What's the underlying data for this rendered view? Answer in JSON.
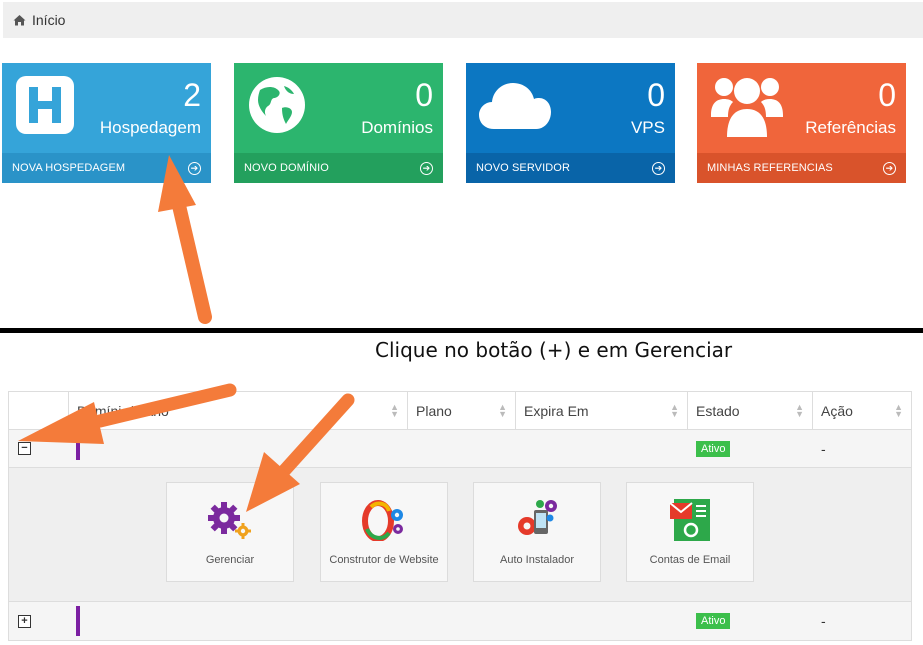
{
  "breadcrumb": {
    "home_icon": "home-icon",
    "label": "Início"
  },
  "tiles": [
    {
      "count": "2",
      "name": "Hospedagem",
      "link": "NOVA HOSPEDAGEM",
      "icon": "hosting-h-icon"
    },
    {
      "count": "0",
      "name": "Domínios",
      "link": "NOVO DOMÍNIO",
      "icon": "globe-icon"
    },
    {
      "count": "0",
      "name": "VPS",
      "link": "NOVO SERVIDOR",
      "icon": "cloud-icon"
    },
    {
      "count": "0",
      "name": "Referências",
      "link": "MINHAS REFERENCIAS",
      "icon": "users-icon"
    }
  ],
  "instruction": "Clique no botão (+) e em Gerenciar",
  "table": {
    "headers": [
      "",
      "Domínio/Plano",
      "Plano",
      "Expira Em",
      "Estado",
      "Ação"
    ],
    "rows": [
      {
        "toggle": "−",
        "status": "Ativo",
        "action": "-"
      },
      {
        "toggle": "+",
        "status": "Ativo",
        "action": "-"
      }
    ]
  },
  "actions": [
    {
      "label": "Gerenciar",
      "icon": "gears-icon"
    },
    {
      "label": "Construtor de Website",
      "icon": "website-builder-icon"
    },
    {
      "label": "Auto Instalador",
      "icon": "auto-installer-icon"
    },
    {
      "label": "Contas de Email",
      "icon": "email-accounts-icon"
    }
  ],
  "colors": {
    "hosting": "#35a4d9",
    "domains": "#2cb56e",
    "vps": "#0c77c2",
    "referrals": "#f0653b",
    "arrow": "#f47b3a",
    "active": "#3cbf4b"
  }
}
